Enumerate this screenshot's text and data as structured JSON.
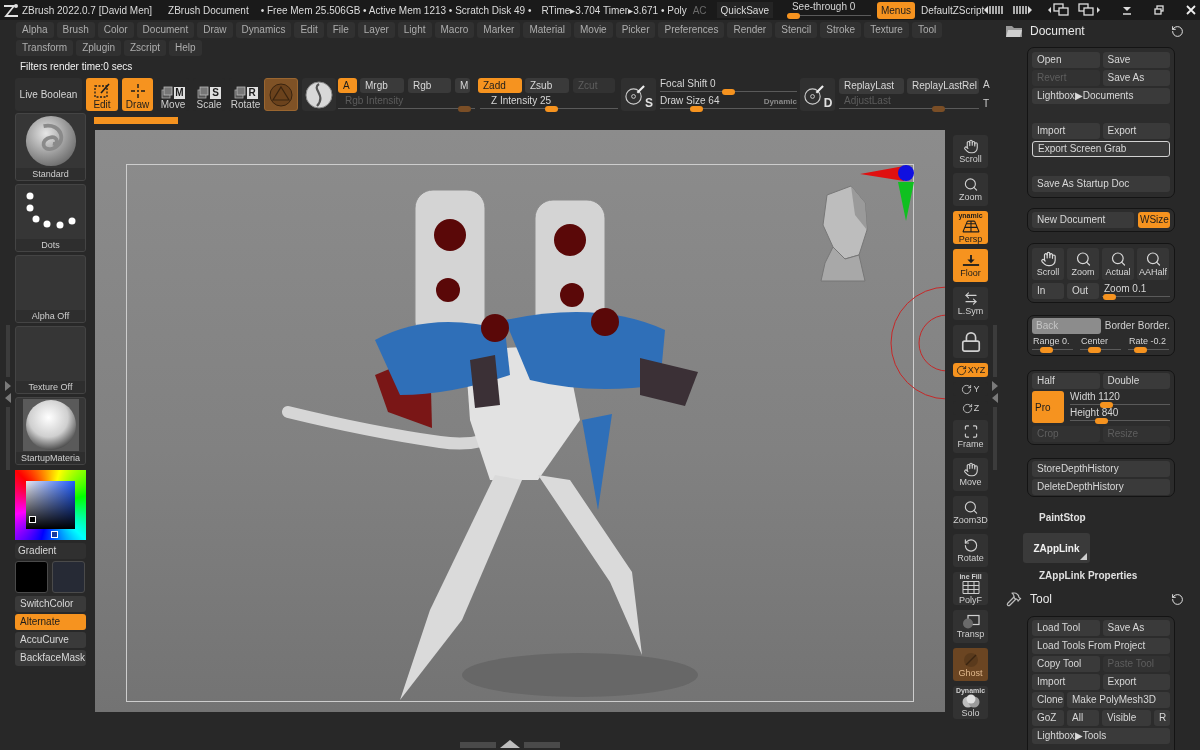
{
  "title_bar": {
    "app_title": "ZBrush 2022.0.7 [David Men]",
    "document_name": "ZBrush Document",
    "memory": "• Free Mem 25.506GB • Active Mem 1213 • Scratch Disk 49 •",
    "timing": "RTime▸3.704 Timer▸3.671 • Poly",
    "ac": "AC",
    "quicksave": "QuickSave",
    "see_through": {
      "label": "See-through",
      "value": "0",
      "level": 0
    },
    "menus": {
      "label": "Menus",
      "on": true
    },
    "zscript": "DefaultZScript"
  },
  "menu_rows": [
    [
      "Alpha",
      "Brush",
      "Color",
      "Document",
      "Draw",
      "Dynamics",
      "Edit",
      "File",
      "Layer",
      "Light",
      "Macro",
      "Marker",
      "Material",
      "Movie",
      "Picker",
      "Preferences",
      "Render",
      "Stencil",
      "Stroke",
      "Texture",
      "Tool"
    ],
    [
      "Transform",
      "Zplugin",
      "Zscript",
      "Help"
    ]
  ],
  "status_message": "Filters render time:0 secs",
  "toolbar": {
    "live_boolean": "Live Boolean",
    "modes": [
      {
        "kind": "edit",
        "label": "Edit",
        "on": true
      },
      {
        "kind": "draw",
        "label": "Draw",
        "on": true
      },
      {
        "kind": "move",
        "letter": "M",
        "label": "Move",
        "on": false
      },
      {
        "kind": "scale",
        "letter": "S",
        "label": "Scale",
        "on": false
      },
      {
        "kind": "rotate",
        "letter": "R",
        "label": "Rotate",
        "on": false
      }
    ],
    "channels": [
      {
        "label": "A",
        "on": true,
        "disabled": false
      },
      {
        "label": "Mrgb",
        "on": false,
        "disabled": false
      },
      {
        "label": "Rgb",
        "on": false,
        "disabled": false
      },
      {
        "label": "M",
        "on": false,
        "disabled": false
      },
      {
        "label": "Zadd",
        "on": true,
        "disabled": false
      },
      {
        "label": "Zsub",
        "on": false,
        "disabled": false
      },
      {
        "label": "Zcut",
        "on": false,
        "disabled": true
      }
    ],
    "intensity_sliders": [
      {
        "label": "Rgb Intensity",
        "level": 0.97,
        "disabled": true
      },
      {
        "label": "Z Intensity",
        "value": "25",
        "level": 0.52,
        "disabled": false
      }
    ],
    "stroke_letter": "S",
    "brush_sliders": [
      {
        "label": "Focal Shift",
        "value": "0",
        "level": 0.5
      },
      {
        "label": "Draw Size",
        "value": "64",
        "level": 0.24
      }
    ],
    "dynamic": "Dynamic",
    "replay_letter": "D",
    "replay_buttons": [
      "ReplayLast",
      "ReplayLastRel"
    ],
    "edge_top": "A",
    "adjust_last": {
      "label": "AdjustLast",
      "level": 0.73,
      "disabled": true
    },
    "edge_bottom": "T"
  },
  "left_palette": {
    "tiles": [
      {
        "kind": "brush",
        "label": "Standard"
      },
      {
        "kind": "stroke",
        "label": "Dots"
      },
      {
        "kind": "alpha",
        "label": "Alpha Off"
      },
      {
        "kind": "texture",
        "label": "Texture Off"
      },
      {
        "kind": "material",
        "label": "StartupMateria"
      }
    ],
    "gradient": "Gradient",
    "swatches": [
      {
        "color": "#000000"
      },
      {
        "color": "#262a35"
      }
    ],
    "buttons": [
      {
        "label": "SwitchColor",
        "on": false
      },
      {
        "label": "Alternate",
        "on": true
      },
      {
        "label": "AccuCurve",
        "on": false
      },
      {
        "label": "BackfaceMask",
        "on": false
      }
    ]
  },
  "view_controls": [
    {
      "kind": "scroll",
      "label": "Scroll",
      "on": false,
      "disabled": false
    },
    {
      "kind": "zoom",
      "label": "Zoom",
      "on": false,
      "disabled": false
    },
    {
      "kind": "persp",
      "caption": "ynamic",
      "label": "Persp",
      "on": true,
      "disabled": false
    },
    {
      "kind": "floor",
      "label": "Floor",
      "on": true,
      "disabled": false
    },
    {
      "kind": "lsym",
      "label": "L.Sym",
      "on": false,
      "disabled": false
    },
    {
      "kind": "lock",
      "on": false,
      "disabled": false
    },
    {
      "kind": "axis",
      "label": "XYZ",
      "on": true,
      "disabled": false
    },
    {
      "kind": "axis",
      "label": "Y",
      "on": false,
      "disabled": false
    },
    {
      "kind": "axis",
      "label": "Z",
      "on": false,
      "disabled": false
    },
    {
      "kind": "frame",
      "label": "Frame",
      "on": false,
      "disabled": false
    },
    {
      "kind": "move",
      "label": "Move",
      "on": false,
      "disabled": false
    },
    {
      "kind": "zoom3d",
      "label": "Zoom3D",
      "on": false,
      "disabled": false
    },
    {
      "kind": "rotate",
      "label": "Rotate",
      "on": false,
      "disabled": false
    },
    {
      "kind": "polyf",
      "caption": "ine Fill",
      "label": "PolyF",
      "on": false,
      "disabled": false
    },
    {
      "kind": "transp",
      "label": "Transp",
      "on": false,
      "disabled": false
    },
    {
      "kind": "ghost",
      "label": "Ghost",
      "on": true,
      "disabled": true
    },
    {
      "kind": "solo",
      "caption": "Dynamic",
      "label": "Solo",
      "on": false,
      "disabled": false
    }
  ],
  "document_palette": {
    "title": "Document",
    "file_rows": [
      [
        {
          "label": "Open",
          "disabled": false,
          "outlined": false
        },
        {
          "label": "Save",
          "disabled": false,
          "outlined": false
        }
      ],
      [
        {
          "label": "Revert",
          "disabled": true,
          "outlined": false
        },
        {
          "label": "Save As",
          "disabled": false,
          "outlined": false
        }
      ],
      [
        {
          "label": "Lightbox▶Documents",
          "disabled": false,
          "outlined": false
        }
      ],
      [
        {
          "label": "Import",
          "disabled": false,
          "outlined": false
        },
        {
          "label": "Export",
          "disabled": false,
          "outlined": false
        }
      ],
      [
        {
          "label": "Export Screen Grab",
          "disabled": false,
          "outlined": true
        }
      ],
      [
        {
          "label": "Save As Startup Doc",
          "disabled": false,
          "outlined": false
        }
      ]
    ],
    "new_document": "New Document",
    "wsize": {
      "label": "WSize",
      "on": true
    },
    "view_buttons": [
      {
        "kind": "scroll",
        "label": "Scroll"
      },
      {
        "kind": "zoom",
        "label": "Zoom"
      },
      {
        "kind": "actual",
        "label": "Actual"
      },
      {
        "kind": "aahalf",
        "label": "AAHalf"
      }
    ],
    "in_out": [
      "In",
      "Out"
    ],
    "zoom_slider": {
      "label": "Zoom",
      "value": "0.1",
      "level": 0.02
    },
    "back": "Back",
    "border_buttons": [
      "Border",
      "Border."
    ],
    "range_sliders": [
      {
        "label": "Range",
        "value": "0.",
        "level": 0.28
      },
      {
        "label": "Center",
        "level": 0.3
      },
      {
        "label": "Rate",
        "value": "-0.2",
        "level": 0.23
      }
    ],
    "size_buttons": [
      "Half",
      "Double"
    ],
    "pro": {
      "label": "Pro",
      "on": true
    },
    "size_sliders": [
      {
        "label": "Width",
        "value": "1120",
        "level": 0.35
      },
      {
        "label": "Height",
        "value": "840",
        "level": 0.29
      }
    ],
    "crop_buttons": [
      {
        "label": "Crop",
        "disabled": true
      },
      {
        "label": "Resize",
        "disabled": true
      }
    ],
    "depth_buttons": [
      "StoreDepthHistory",
      "DeleteDepthHistory"
    ],
    "paintstop": "PaintStop",
    "zapplink": "ZAppLink",
    "zapplink_properties": "ZAppLink Properties"
  },
  "tool_palette": {
    "title": "Tool",
    "rows": [
      [
        {
          "label": "Load Tool",
          "disabled": false
        },
        {
          "label": "Save As",
          "disabled": false
        }
      ],
      [
        {
          "label": "Load Tools From Project",
          "disabled": false
        }
      ],
      [
        {
          "label": "Copy Tool",
          "disabled": false
        },
        {
          "label": "Paste Tool",
          "disabled": true
        }
      ],
      [
        {
          "label": "Import",
          "disabled": false
        },
        {
          "label": "Export",
          "disabled": false
        }
      ],
      [
        {
          "label": "Clone",
          "disabled": false
        },
        {
          "label": "Make PolyMesh3D",
          "disabled": false
        }
      ],
      [
        {
          "label": "GoZ",
          "disabled": false
        },
        {
          "label": "All",
          "disabled": false
        },
        {
          "label": "Visible",
          "disabled": false
        },
        {
          "label": "R",
          "disabled": false
        }
      ],
      [
        {
          "label": "Lightbox▶Tools",
          "disabled": false
        }
      ]
    ]
  }
}
